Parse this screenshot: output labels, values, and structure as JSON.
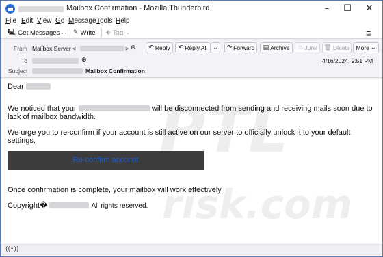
{
  "window": {
    "title": "Mailbox Confirmation - Mozilla Thunderbird",
    "minimize": "–",
    "maximize": "☐",
    "close": "✕"
  },
  "menu": {
    "items": [
      {
        "key": "F",
        "rest": "ile"
      },
      {
        "key": "E",
        "rest": "dit"
      },
      {
        "key": "V",
        "rest": "iew"
      },
      {
        "key": "G",
        "rest": "o"
      },
      {
        "key": "M",
        "rest": "essage"
      },
      {
        "key": "T",
        "rest": "ools"
      },
      {
        "key": "H",
        "rest": "elp"
      }
    ]
  },
  "toolbar": {
    "get_messages": "Get Messages",
    "write": "Write",
    "tag": "Tag",
    "overflow": "≡"
  },
  "header": {
    "from_label": "From",
    "from_name": "Mailbox Server <",
    "from_close": ">",
    "to_label": "To",
    "subject_label": "Subject",
    "subject": "Mailbox Confirmation",
    "date": "4/16/2024, 9:51 PM",
    "actions": {
      "reply": "Reply",
      "reply_all": "Reply All",
      "forward": "Forward",
      "archive": "Archive",
      "junk": "Junk",
      "delete": "Delete",
      "more": "More"
    }
  },
  "body": {
    "greeting": "Dear",
    "line1_a": "We noticed that your",
    "line1_b": "will be disconnected from sending and receiving mails",
    "line1_c": "soon due to lack of mailbox bandwidth.",
    "line2": "We urge you to re-confirm if your account is still active on our server to officially unlock it to your default settings.",
    "cta": "Re-confirm account",
    "line3": "Once confirmation is complete, your mailbox will work effectively.",
    "copyright_a": "Copyright�",
    "copyright_b": "All rights reserved."
  },
  "watermark": {
    "top": "PTL",
    "bottom": "risk.com"
  },
  "colors": {
    "cta_background": "#3c3c3e",
    "cta_text": "#1f5fd0",
    "accent": "#2a6fd6"
  }
}
